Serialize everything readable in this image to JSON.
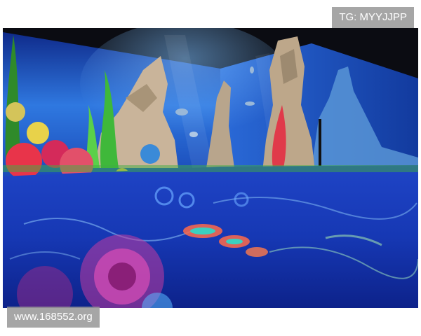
{
  "watermark_top": "TG: MYYJJPP",
  "watermark_bottom": "www.168552.org",
  "scene": {
    "subject": "immersive-aquarium-projection-room",
    "colors": {
      "ceiling": "#0b0c12",
      "water_deep": "#0d1f7a",
      "water_light": "#3f8ff0",
      "floor": "#1736b8",
      "rock": "#c9b49a",
      "coral_red": "#e8344a",
      "seaweed": "#3fb83a"
    }
  }
}
